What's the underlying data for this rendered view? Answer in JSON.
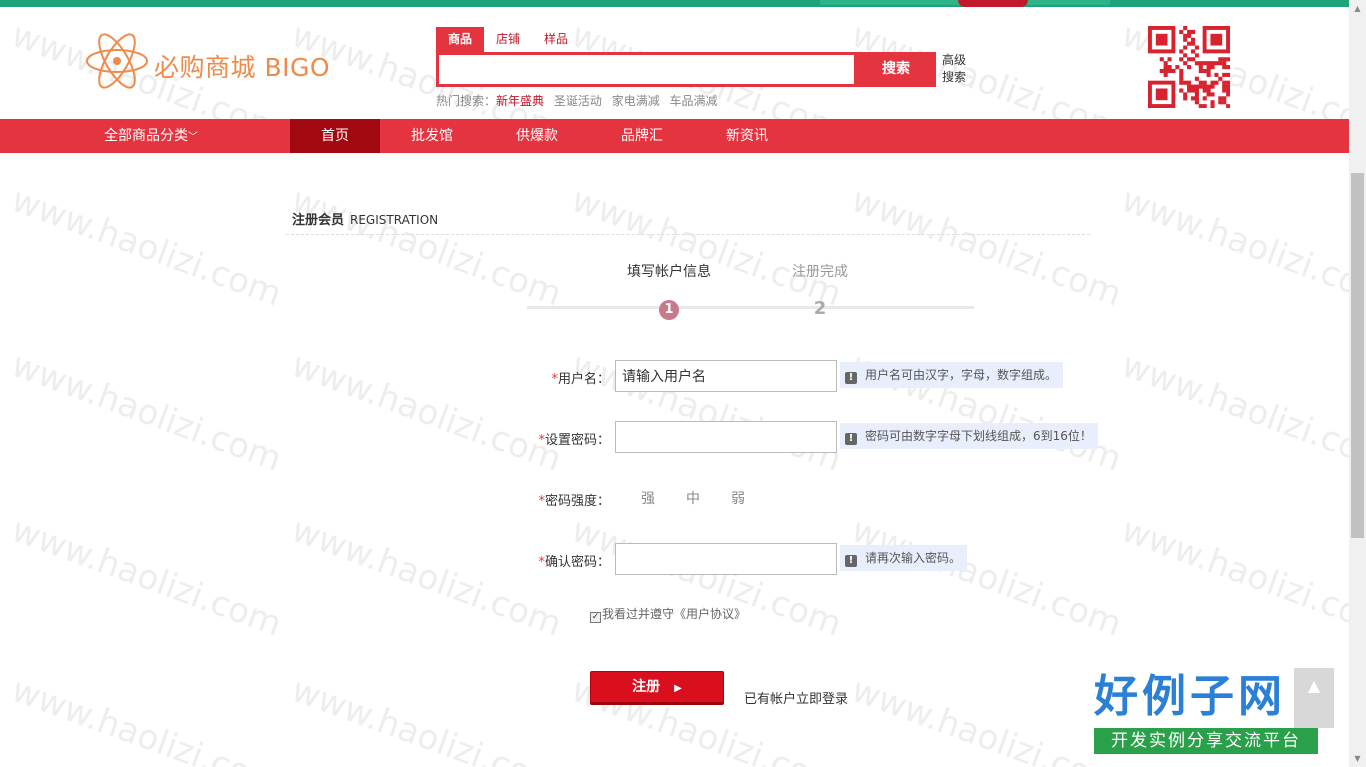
{
  "brand": {
    "logo_text": "必购商城 BIGO"
  },
  "search": {
    "tabs": [
      "商品",
      "店铺",
      "样品"
    ],
    "placeholder": "",
    "button_label": "搜索",
    "advanced_label": "高级搜索",
    "hot_label": "热门搜索：",
    "hot_keywords": [
      "新年盛典",
      "圣诞活动",
      "家电满减",
      "车品满减"
    ]
  },
  "nav": {
    "all_categories": "全部商品分类",
    "items": [
      "首页",
      "批发馆",
      "供爆款",
      "品牌汇",
      "新资讯"
    ]
  },
  "section": {
    "title": "注册会员",
    "subtitle": "REGISTRATION"
  },
  "steps": [
    {
      "num": "1",
      "label": "填写帐户信息"
    },
    {
      "num": "2",
      "label": "注册完成"
    }
  ],
  "form": {
    "username": {
      "label": "用户名：",
      "value": "请输入用户名",
      "hint": "用户名可由汉字，字母，数字组成。"
    },
    "password": {
      "label": "设置密码：",
      "value": "",
      "hint": "密码可由数字字母下划线组成，6到16位！"
    },
    "strength": {
      "label": "密码强度：",
      "levels": [
        "强",
        "中",
        "弱"
      ]
    },
    "confirm": {
      "label": "确认密码：",
      "value": "",
      "hint": "请再次输入密码。"
    },
    "required_mark": "*"
  },
  "agreement": {
    "text": "我看过并遵守《用户协议》",
    "checked": true
  },
  "actions": {
    "register_label": "注册",
    "login_link": "已有帐户立即登录"
  },
  "watermark": {
    "text": "www.haolizi.com",
    "brand_main": "好例子网",
    "brand_sub": "开发实例分享交流平台"
  },
  "colors": {
    "primary_red": "#e3343f",
    "nav_active": "#a1080f",
    "top_green": "#1ea37c",
    "logo_orange": "#f08a4a"
  }
}
